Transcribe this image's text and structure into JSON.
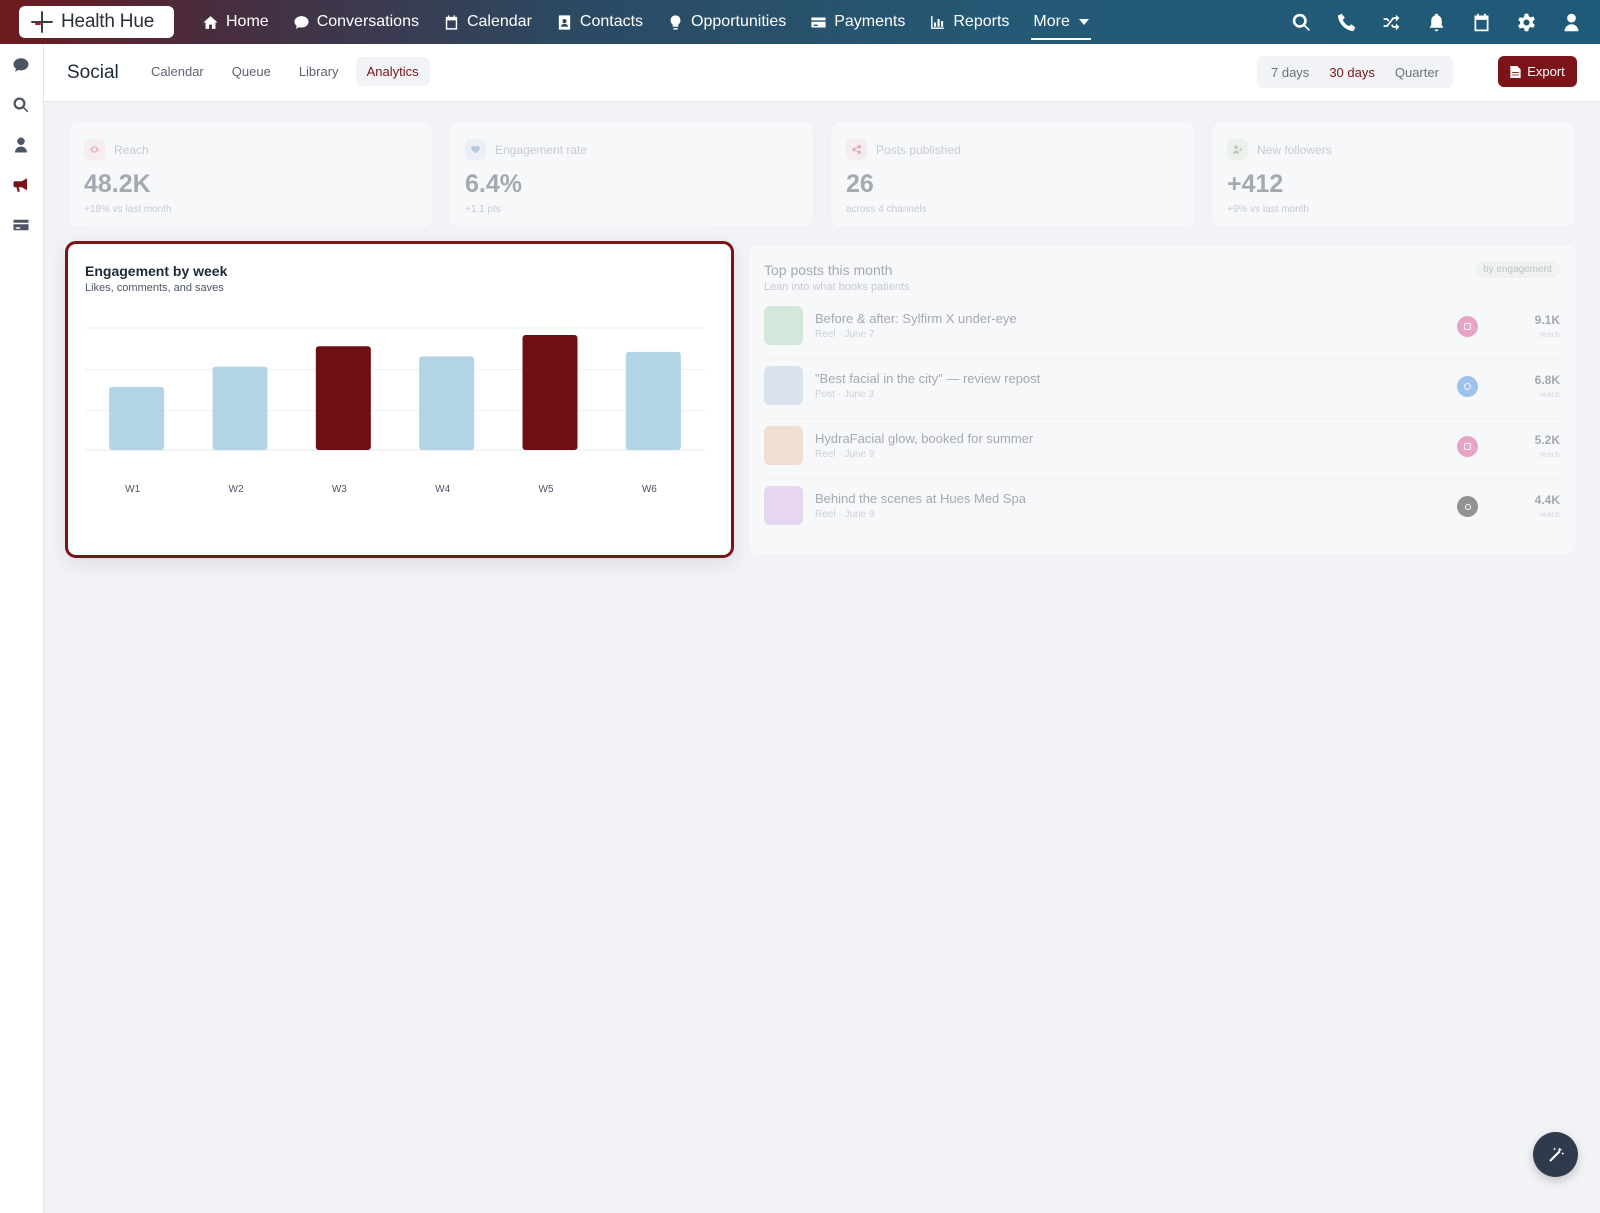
{
  "app": {
    "brand": "Health Hue"
  },
  "nav": {
    "items": [
      {
        "label": "Home",
        "icon": "home-icon"
      },
      {
        "label": "Conversations",
        "icon": "chat-bubble-icon"
      },
      {
        "label": "Calendar",
        "icon": "calendar-icon"
      },
      {
        "label": "Contacts",
        "icon": "contact-card-icon"
      },
      {
        "label": "Opportunities",
        "icon": "lightbulb-icon"
      },
      {
        "label": "Payments",
        "icon": "credit-card-icon"
      },
      {
        "label": "Reports",
        "icon": "bar-chart-icon"
      }
    ],
    "more_label": "More",
    "right_icons": [
      "search-icon",
      "phone-icon",
      "shuffle-icon",
      "bell-icon",
      "calendar-icon",
      "gear-icon",
      "user-icon"
    ]
  },
  "rail": {
    "icons": [
      "chat-icon",
      "search-icon",
      "user-icon",
      "megaphone-icon",
      "card-icon"
    ],
    "active": "megaphone-icon"
  },
  "subheader": {
    "title": "Social",
    "tabs": [
      {
        "label": "Calendar",
        "active": false
      },
      {
        "label": "Queue",
        "active": false
      },
      {
        "label": "Library",
        "active": false
      },
      {
        "label": "Analytics",
        "active": true
      }
    ],
    "ranges": [
      {
        "label": "7 days",
        "active": false
      },
      {
        "label": "30 days",
        "active": true
      },
      {
        "label": "Quarter",
        "active": false
      }
    ],
    "export_label": "Export"
  },
  "stats": [
    {
      "label": "Reach",
      "value": "48.2K",
      "sub": "+18% vs last month",
      "icon": "eye-icon",
      "color": "#e2677d"
    },
    {
      "label": "Engagement rate",
      "value": "6.4%",
      "sub": "+1.1 pts",
      "icon": "heart-icon",
      "color": "#5a8fc0"
    },
    {
      "label": "Posts published",
      "value": "26",
      "sub": "across 4 channels",
      "icon": "share-icon",
      "color": "#c2587a"
    },
    {
      "label": "New followers",
      "value": "+412",
      "sub": "+9% vs last month",
      "icon": "user-plus-icon",
      "color": "#6b9a6b"
    }
  ],
  "chart": {
    "title": "Engagement by week",
    "subtitle": "Likes, comments, and saves"
  },
  "chart_data": {
    "type": "bar",
    "categories": [
      "W1",
      "W2",
      "W3",
      "W4",
      "W5",
      "W6"
    ],
    "values": [
      56,
      74,
      92,
      83,
      102,
      87
    ],
    "highlighted": [
      "W3",
      "W5"
    ],
    "ylim": [
      0,
      110
    ],
    "grid": true,
    "colors": {
      "default": "#b2d4e4",
      "highlight": "#6e0f14"
    }
  },
  "top_posts": {
    "title": "Top posts this month",
    "subtitle": "Lean into what books patients",
    "badge": "by engagement",
    "reach_label": "reach",
    "rows": [
      {
        "title": "Before & after: Sylfirm X under-eye",
        "meta": "Reel · June 7",
        "reach": "9.1K",
        "channel": "instagram",
        "channel_color": "#d63c7f",
        "thumb": "#a9dbb6"
      },
      {
        "title": "\"Best facial in the city\" — review repost",
        "meta": "Post · June 3",
        "reach": "6.8K",
        "channel": "facebook",
        "channel_color": "#2f7de1",
        "thumb": "#b7cde3"
      },
      {
        "title": "HydraFacial glow, booked for summer",
        "meta": "Reel · June 9",
        "reach": "5.2K",
        "channel": "instagram",
        "channel_color": "#d63c7f",
        "thumb": "#f0c3a3"
      },
      {
        "title": "Behind the scenes at Hues Med Spa",
        "meta": "Reel · June 9",
        "reach": "4.4K",
        "channel": "tiktok",
        "channel_color": "#111111",
        "thumb": "#d6b0e6"
      }
    ]
  },
  "fab": {
    "icon": "magic-wand-icon"
  }
}
